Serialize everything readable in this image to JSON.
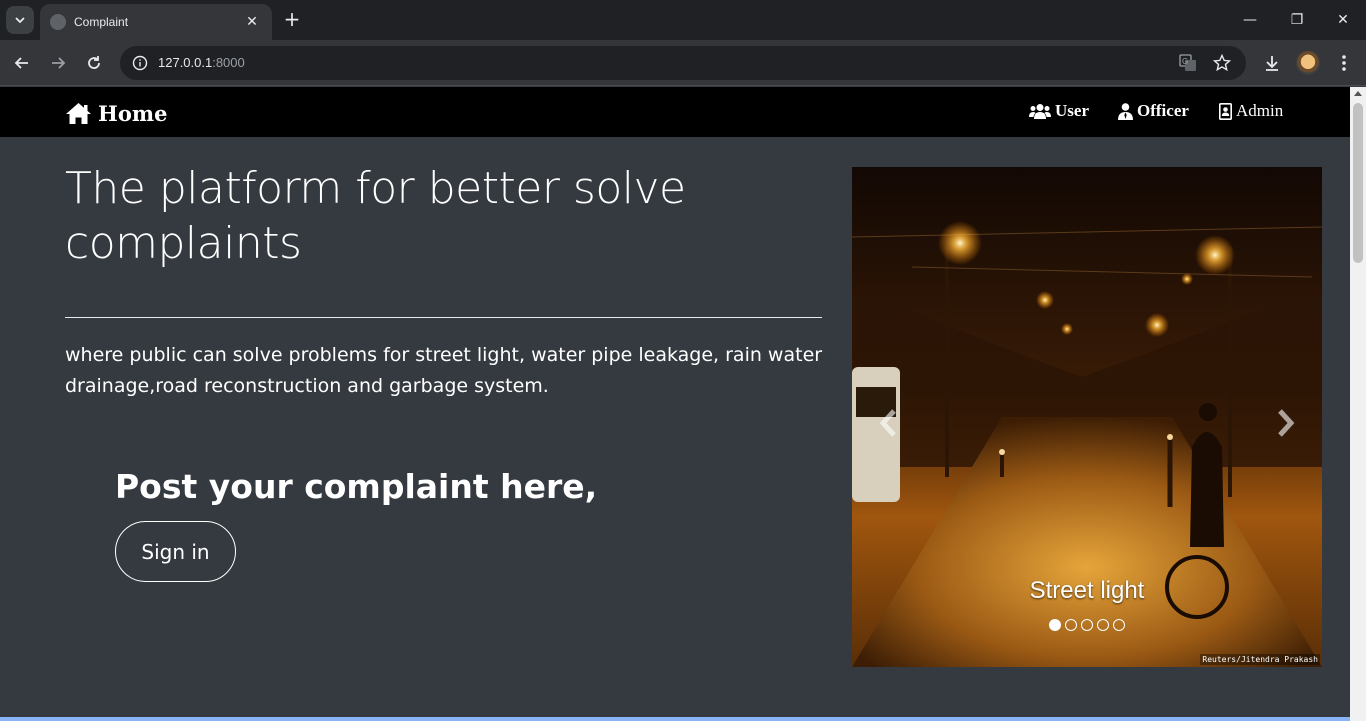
{
  "browser": {
    "tab_title": "Complaint",
    "url_host": "127.0.0.1",
    "url_port": ":8000"
  },
  "navbar": {
    "brand": "Home",
    "links": [
      {
        "label": "User",
        "icon": "users-icon"
      },
      {
        "label": "Officer",
        "icon": "user-tie-icon"
      },
      {
        "label": "Admin",
        "icon": "id-badge-icon"
      }
    ]
  },
  "hero": {
    "headline": "The platform for better solve complaints",
    "lead": "where public can solve problems for street light, water pipe leakage, rain water drainage,road reconstruction and garbage system.",
    "post_title": "Post your complaint here,",
    "signin_label": "Sign in"
  },
  "carousel": {
    "caption": "Street light",
    "credit": "Reuters/Jitendra Prakash",
    "slide_count": 5,
    "active_index": 0
  },
  "colors": {
    "page_bg": "#343a40",
    "navbar_bg": "#000000",
    "text": "#ffffff"
  }
}
